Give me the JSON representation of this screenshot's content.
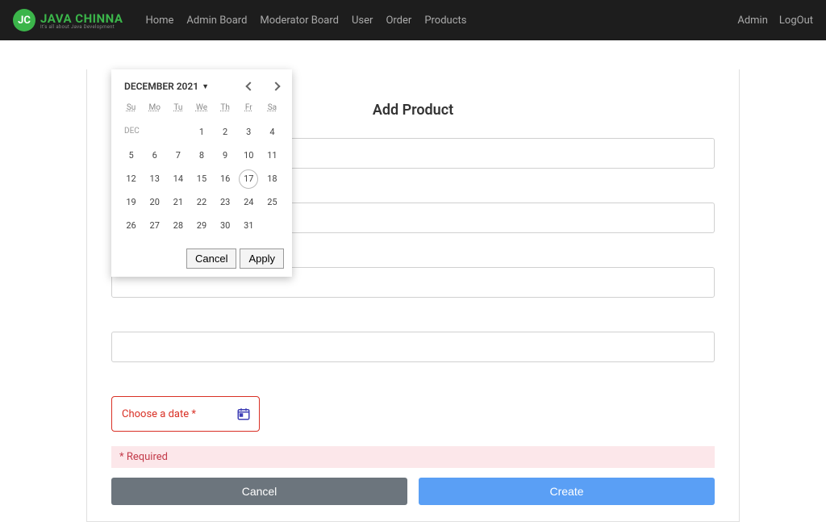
{
  "brand": {
    "badge": "JC",
    "name": "JAVA CHINNA",
    "sub": "It's all about Java Development"
  },
  "nav": {
    "home": "Home",
    "admin": "Admin Board",
    "moderator": "Moderator Board",
    "user": "User",
    "order": "Order",
    "products": "Products",
    "adminLink": "Admin",
    "logout": "LogOut"
  },
  "page": {
    "title": "Add Product"
  },
  "dateField": {
    "label": "Choose a date *"
  },
  "required": {
    "text": "* Required"
  },
  "buttons": {
    "cancel": "Cancel",
    "create": "Create"
  },
  "datepicker": {
    "title": "DECEMBER 2021",
    "monthLabel": "DEC",
    "dow": [
      "Su",
      "Mo",
      "Tu",
      "We",
      "Th",
      "Fr",
      "Sa"
    ],
    "today": 17,
    "cancel": "Cancel",
    "apply": "Apply"
  }
}
